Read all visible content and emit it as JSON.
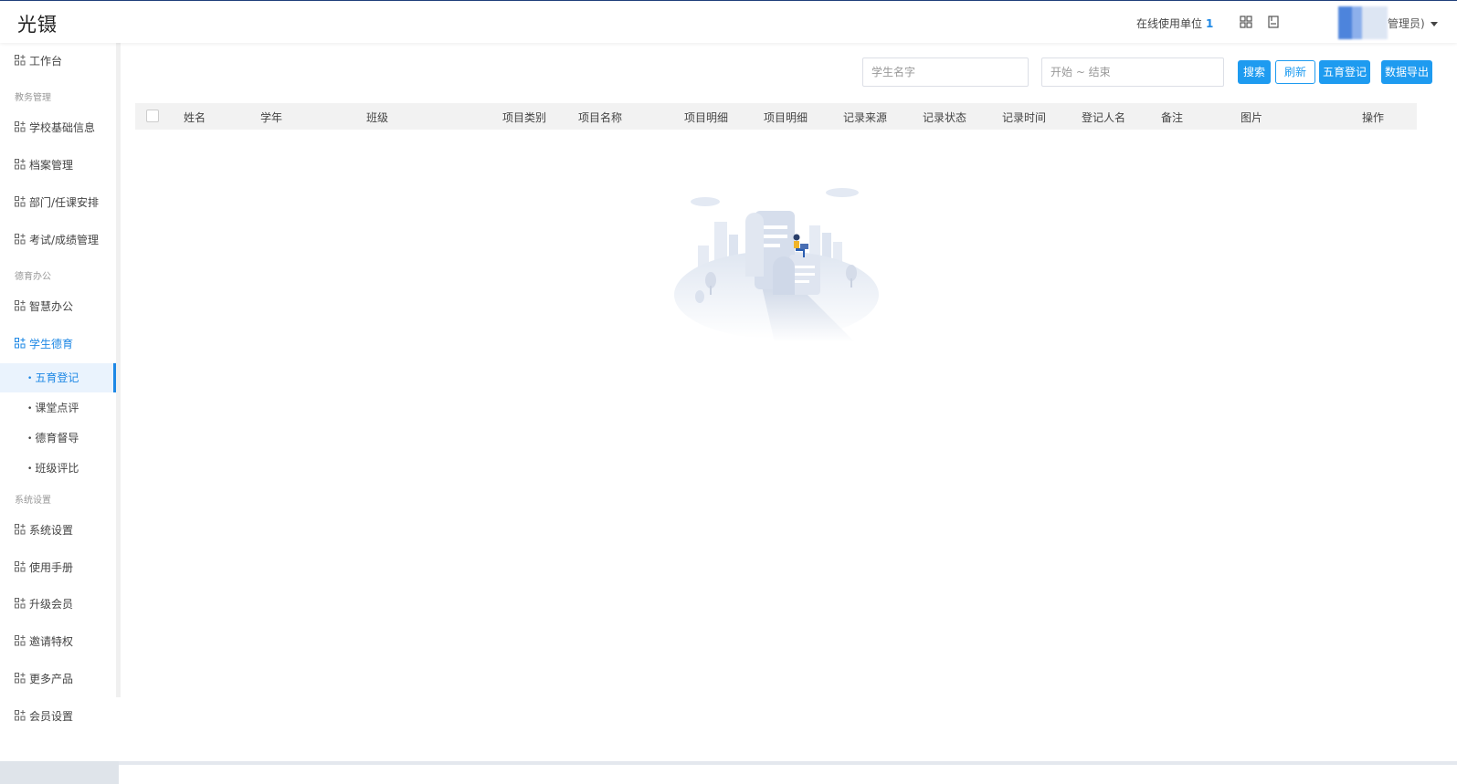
{
  "header": {
    "logo": "光镊",
    "online_label": "在线使用单位",
    "online_count": "1",
    "grid_icon": "apps-grid-icon",
    "doc_icon": "document-icon",
    "user_label": "管理员)"
  },
  "sidebar": {
    "items": [
      {
        "label": "工作台",
        "icon": "grid-plus-icon"
      },
      {
        "section": "教务管理"
      },
      {
        "label": "学校基础信息",
        "icon": "grid-plus-icon"
      },
      {
        "label": "档案管理",
        "icon": "grid-plus-icon"
      },
      {
        "label": "部门/任课安排",
        "icon": "grid-plus-icon"
      },
      {
        "label": "考试/成绩管理",
        "icon": "grid-plus-icon"
      },
      {
        "section": "德育办公"
      },
      {
        "label": "智慧办公",
        "icon": "grid-plus-icon"
      },
      {
        "label": "学生德育",
        "icon": "grid-plus-icon",
        "active": true
      }
    ],
    "sub_items": [
      {
        "label": "五育登记",
        "active": true
      },
      {
        "label": "课堂点评"
      },
      {
        "label": "德育督导"
      },
      {
        "label": "班级评比"
      }
    ],
    "items2": [
      {
        "section": "系统设置"
      },
      {
        "label": "系统设置",
        "icon": "grid-plus-icon"
      },
      {
        "label": "使用手册",
        "icon": "grid-plus-icon"
      },
      {
        "label": "升级会员",
        "icon": "grid-plus-icon"
      },
      {
        "label": "邀请特权",
        "icon": "grid-plus-icon"
      },
      {
        "label": "更多产品",
        "icon": "grid-plus-icon"
      },
      {
        "label": "会员设置",
        "icon": "grid-plus-icon"
      }
    ]
  },
  "toolbar": {
    "name_placeholder": "学生名字",
    "date_placeholder": "开始 ~ 结束",
    "search_label": "搜索",
    "refresh_label": "刷新",
    "register_label": "五育登记",
    "export_label": "数据导出"
  },
  "table": {
    "columns": [
      "姓名",
      "学年",
      "班级",
      "项目类别",
      "项目名称",
      "项目明细",
      "项目明细",
      "记录来源",
      "记录状态",
      "记录时间",
      "登记人名",
      "备注",
      "图片",
      "操作"
    ],
    "rows": []
  },
  "colors": {
    "accent": "#1e9bf0",
    "active_text": "#1e88e5"
  }
}
